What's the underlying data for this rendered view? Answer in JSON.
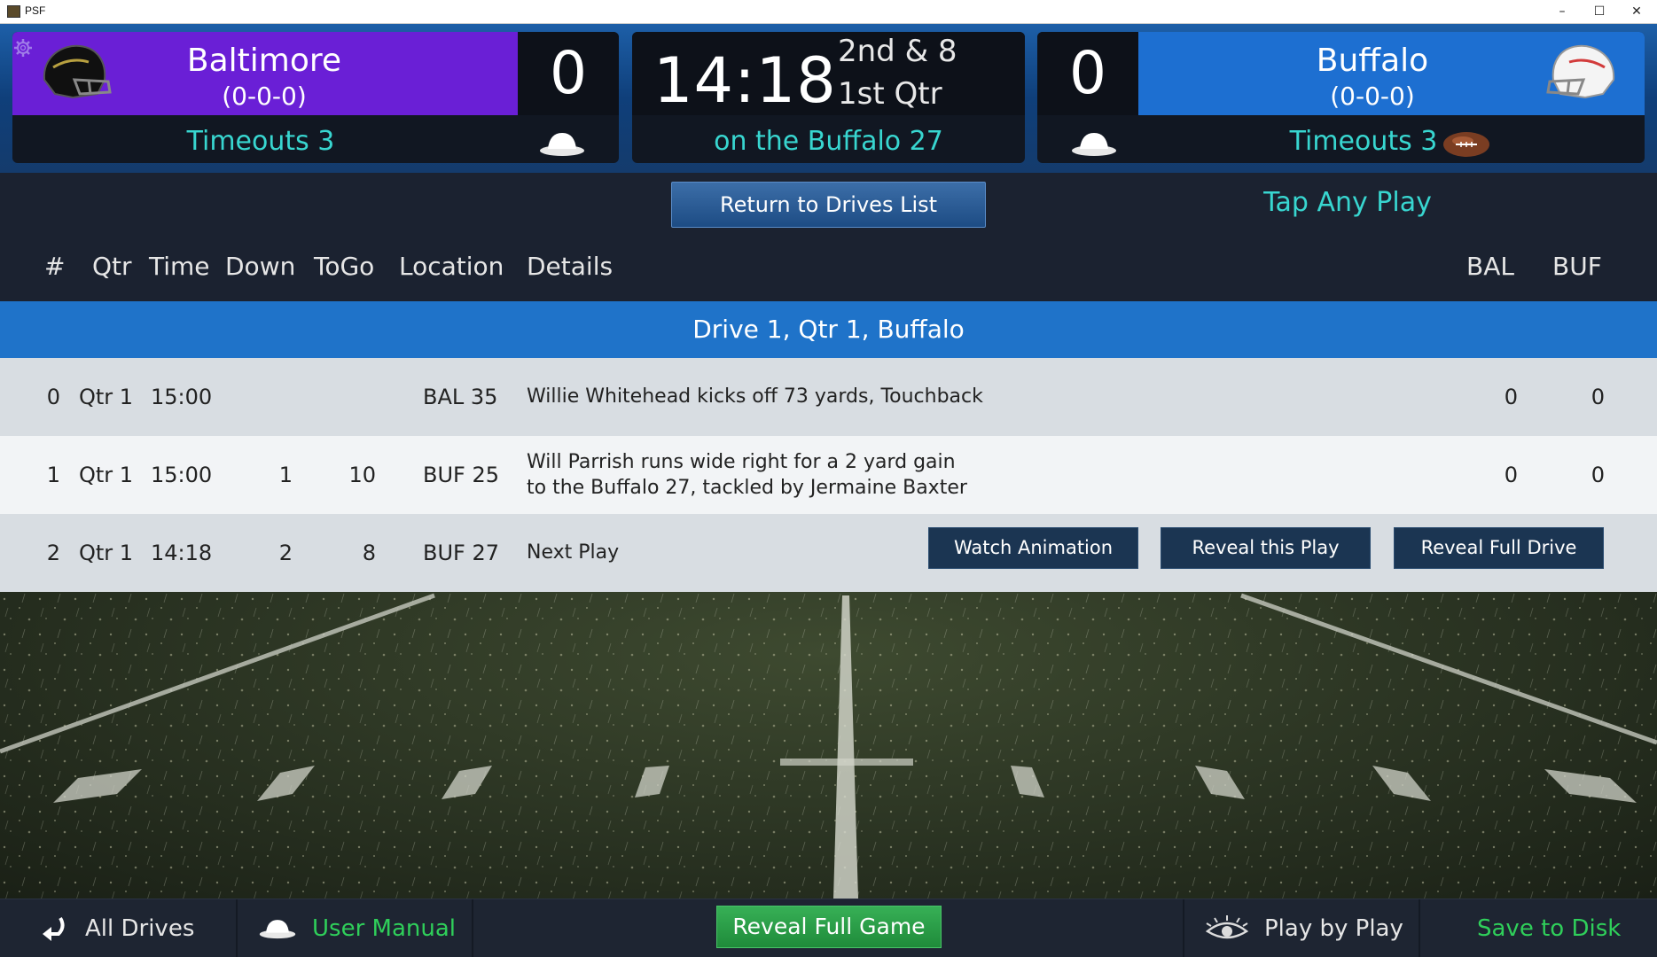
{
  "window": {
    "title": "PSF"
  },
  "scoreboard": {
    "home": {
      "name": "Baltimore",
      "record": "(0-0-0)",
      "score": "0",
      "timeouts": "Timeouts 3",
      "color": "#6a1fd6"
    },
    "away": {
      "name": "Buffalo",
      "record": "(0-0-0)",
      "score": "0",
      "timeouts": "Timeouts 3",
      "color": "#1d6fd1"
    },
    "clock": "14:18",
    "down_distance": "2nd & 8",
    "quarter": "1st Qtr",
    "ball_on": "on the Buffalo 27"
  },
  "controls": {
    "return_label": "Return to Drives List",
    "tap_any_play": "Tap Any Play"
  },
  "columns": [
    "#",
    "Qtr",
    "Time",
    "Down",
    "ToGo",
    "Location",
    "Details",
    "BAL",
    "BUF"
  ],
  "drive": {
    "banner": "Drive 1, Qtr 1, Buffalo"
  },
  "plays": [
    {
      "num": "0",
      "qtr": "Qtr 1",
      "time": "15:00",
      "down": "",
      "togo": "",
      "location": "BAL 35",
      "details_line1": "Willie Whitehead kicks off 73 yards, Touchback",
      "details_line2": "",
      "bal": "0",
      "buf": "0"
    },
    {
      "num": "1",
      "qtr": "Qtr 1",
      "time": "15:00",
      "down": "1",
      "togo": "10",
      "location": "BUF 25",
      "details_line1": "Will Parrish runs wide right for a 2 yard gain",
      "details_line2": "to the Buffalo 27, tackled by Jermaine Baxter",
      "bal": "0",
      "buf": "0"
    },
    {
      "num": "2",
      "qtr": "Qtr 1",
      "time": "14:18",
      "down": "2",
      "togo": "8",
      "location": "BUF 27",
      "details_line1": "Next Play",
      "details_line2": "",
      "bal": "",
      "buf": ""
    }
  ],
  "play_actions": {
    "watch": "Watch Animation",
    "reveal_play": "Reveal this Play",
    "reveal_drive": "Reveal Full Drive"
  },
  "bottom_bar": {
    "all_drives": "All Drives",
    "user_manual": "User Manual",
    "reveal_full_game": "Reveal Full Game",
    "play_by_play": "Play by Play",
    "save_to_disk": "Save to Disk"
  },
  "icons": {
    "settings": "gear-icon",
    "home_helmet": "helmet-icon",
    "away_helmet": "helmet-icon",
    "timeout": "hat-icon",
    "possession": "football-icon",
    "back": "back-arrow-icon",
    "manual": "hat-icon",
    "play_by_play": "eye-icon"
  },
  "accent_colors": {
    "cyan": "#38d6d0",
    "green": "#2fcf5a",
    "banner_blue": "#1f73c9"
  }
}
